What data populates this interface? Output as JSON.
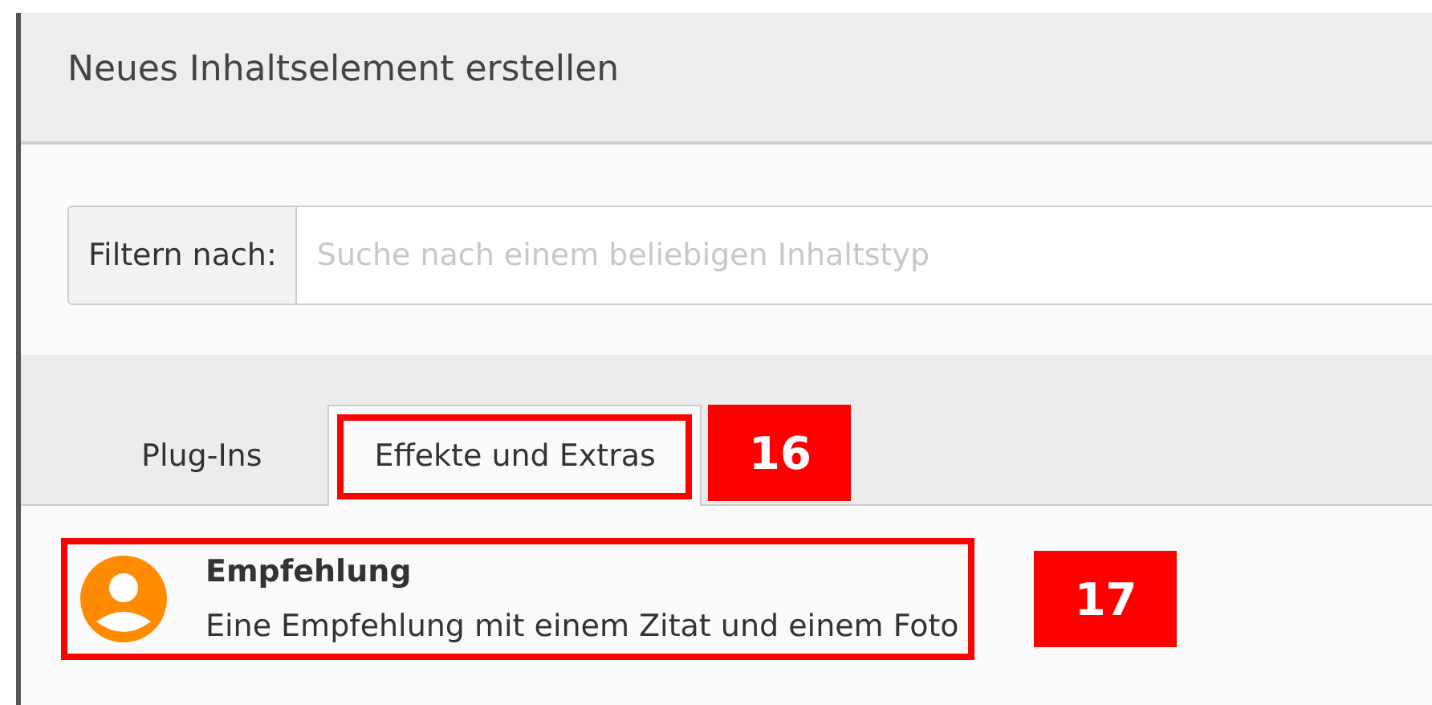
{
  "dialog": {
    "title": "Neues Inhaltselement erstellen"
  },
  "filter": {
    "label": "Filtern nach:",
    "placeholder": "Suche nach einem beliebigen Inhaltstyp"
  },
  "tabs": [
    {
      "label": "Plug-Ins",
      "selected": false
    },
    {
      "label": "Effekte und Extras",
      "selected": true,
      "callout": "16"
    }
  ],
  "items": [
    {
      "title": "Empfehlung",
      "description": "Eine Empfehlung mit einem Zitat und einem Foto",
      "color": "#ff8c00",
      "callout": "17"
    }
  ]
}
